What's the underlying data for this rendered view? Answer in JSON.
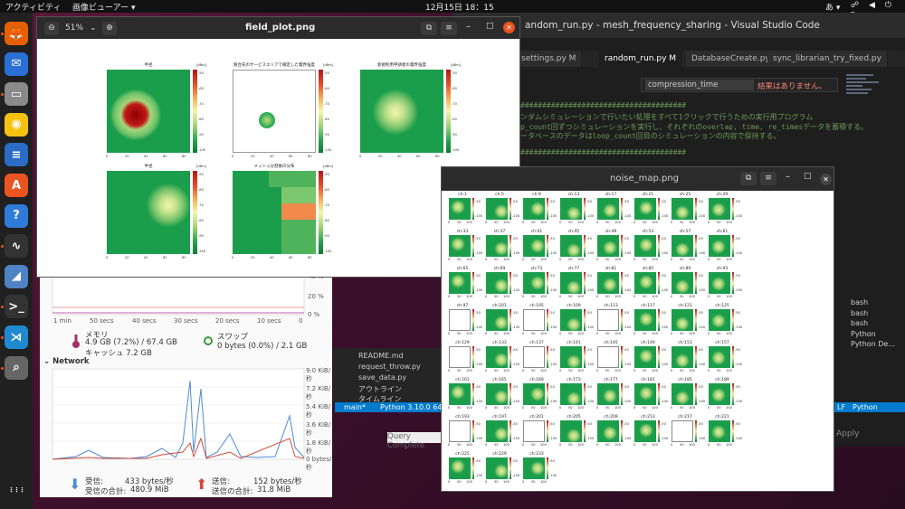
{
  "topbar": {
    "activities": "アクティビティ",
    "app_menu": "画像ビューアー ▾",
    "clock": "12月15日  18：15",
    "ime": "あ ▾",
    "tray": "☍ ◀ ⏻ ▾"
  },
  "dock": {
    "items": [
      {
        "name": "firefox-icon",
        "glyph": "🦊",
        "color": "#e66000"
      },
      {
        "name": "thunderbird-icon",
        "glyph": "✉",
        "color": "#2a6fd6"
      },
      {
        "name": "files-icon",
        "glyph": "▭",
        "color": "#8a8a8a"
      },
      {
        "name": "rhythmbox-icon",
        "glyph": "◉",
        "color": "#f5c211"
      },
      {
        "name": "writer-icon",
        "glyph": "≡",
        "color": "#2b6cc4"
      },
      {
        "name": "app-center-icon",
        "glyph": "A",
        "color": "#e95420"
      },
      {
        "name": "help-icon",
        "glyph": "?",
        "color": "#2f7bd9"
      },
      {
        "name": "system-monitor-icon",
        "glyph": "∿",
        "color": "#333"
      },
      {
        "name": "wireshark-icon",
        "glyph": "◢",
        "color": "#4f83c6"
      },
      {
        "name": "terminal-icon",
        "glyph": ">_",
        "color": "#333"
      },
      {
        "name": "vscode-icon",
        "glyph": "⋊",
        "color": "#1f8ad2"
      },
      {
        "name": "image-viewer-icon",
        "glyph": "⌕",
        "color": "#666"
      },
      {
        "name": "show-apps-icon",
        "glyph": "⋮⋮⋮",
        "color": "#202020"
      }
    ]
  },
  "vscode": {
    "title": "andom_run.py - mesh_frequency_sharing - Visual Studio Code",
    "tabs": [
      "settings.py M",
      "random_run.py M",
      "DatabaseCreate.py",
      "sync_librarian_try_fixed.py"
    ],
    "find_query": "compression_time",
    "find_options": "Aa ab .*",
    "find_result": "結果はありません。",
    "code_lines": [
      "ンダムシミュレーションで行いたい処理をすべて1クリックで行うための実行用プログラム",
      "p_count回ずつシミュレーションを実行し、それぞれのoverlap, time, re_timesデータを蓄積する。",
      "ータベースのデータはloop_count回目のシミュレーションの内容で保持する。"
    ],
    "hash_line": "######################################",
    "terminals": [
      "bash",
      "bash",
      "bash",
      "Python",
      "Python De..."
    ],
    "status_items": [
      "main*",
      "Python 3.10.0 64-bit",
      "LF",
      "Python"
    ],
    "explorer_items": [
      "README.md",
      "request_throw.py",
      "save_data.py",
      "アウトライン",
      "タイムライン"
    ]
  },
  "sysmon": {
    "time_axis": [
      "1 min",
      "50 secs",
      "40 secs",
      "30 secs",
      "20 secs",
      "10 secs",
      "0"
    ],
    "pct_labels": [
      "40 %",
      "20 %",
      "0 %"
    ],
    "memory_label": "メモリ",
    "memory_value": "4.9 GB (7.2%) / 67.4 GB",
    "cache_value": "キャッシュ 7.2 GB",
    "swap_label": "スワップ",
    "swap_value": "0 bytes (0.0%) / 2.1 GB",
    "network_title": "Network",
    "net_axis": [
      "9.0 KiB/秒",
      "7.2 KiB/秒",
      "5.4 KiB/秒",
      "3.6 KiB/秒",
      "1.8 KiB/秒",
      "0 bytes/秒"
    ],
    "recv_label": "受信:",
    "recv_rate": "433 bytes/秒",
    "recv_total_label": "受信の合計:",
    "recv_total": "480.9 MiB",
    "send_label": "送信:",
    "send_rate": "152 bytes/秒",
    "send_total_label": "送信の合計:",
    "send_total": "31.8 MiB"
  },
  "field_window": {
    "title": "field_plot.png",
    "zoom": "51%",
    "plots": [
      {
        "title": "半径",
        "unit": "[dBm]"
      },
      {
        "title": "競合先のサービスエリアで確定した電界強度",
        "unit": "[dBm]"
      },
      {
        "title": "新規利用申請者の電界強度",
        "unit": "[dBm]"
      },
      {
        "title": "半径",
        "unit": "[dBm]"
      },
      {
        "title": "メッシュ分割後の分布",
        "unit": "[dBm]"
      }
    ],
    "x_ticks": [
      "0",
      "20",
      "40",
      "60",
      "80"
    ],
    "cbar_ticks": [
      "-50",
      "-60",
      "-70",
      "-80",
      "-90",
      "-100"
    ]
  },
  "noise_window": {
    "title": "noise_map.png",
    "cells": [
      "ch:1",
      "ch:5",
      "ch:9",
      "ch:13",
      "ch:17",
      "ch:21",
      "ch:25",
      "ch:29",
      "ch:33",
      "ch:37",
      "ch:41",
      "ch:45",
      "ch:49",
      "ch:53",
      "ch:57",
      "ch:61",
      "ch:65",
      "ch:69",
      "ch:73",
      "ch:77",
      "ch:81",
      "ch:85",
      "ch:89",
      "ch:93",
      "ch:97",
      "ch:101",
      "ch:105",
      "ch:109",
      "ch:113",
      "ch:117",
      "ch:121",
      "ch:125",
      "ch:129",
      "ch:133",
      "ch:137",
      "ch:141",
      "ch:145",
      "ch:149",
      "ch:153",
      "ch:157",
      "ch:161",
      "ch:165",
      "ch:169",
      "ch:173",
      "ch:177",
      "ch:181",
      "ch:185",
      "ch:189",
      "ch:193",
      "ch:197",
      "ch:201",
      "ch:205",
      "ch:209",
      "ch:213",
      "ch:217",
      "ch:221",
      "ch:225",
      "ch:229",
      "ch:233"
    ],
    "blank_cells": [
      "ch:97",
      "ch:105",
      "ch:113",
      "ch:129",
      "ch:137",
      "ch:145",
      "ch:193",
      "ch:201",
      "ch:217"
    ],
    "y_tick": "100",
    "cb_ticks": [
      "-50",
      "-100"
    ],
    "x_ticks": [
      "0",
      "50",
      "100"
    ]
  },
  "background": {
    "query_text": "Query Complete",
    "apply_text": "Apply"
  }
}
